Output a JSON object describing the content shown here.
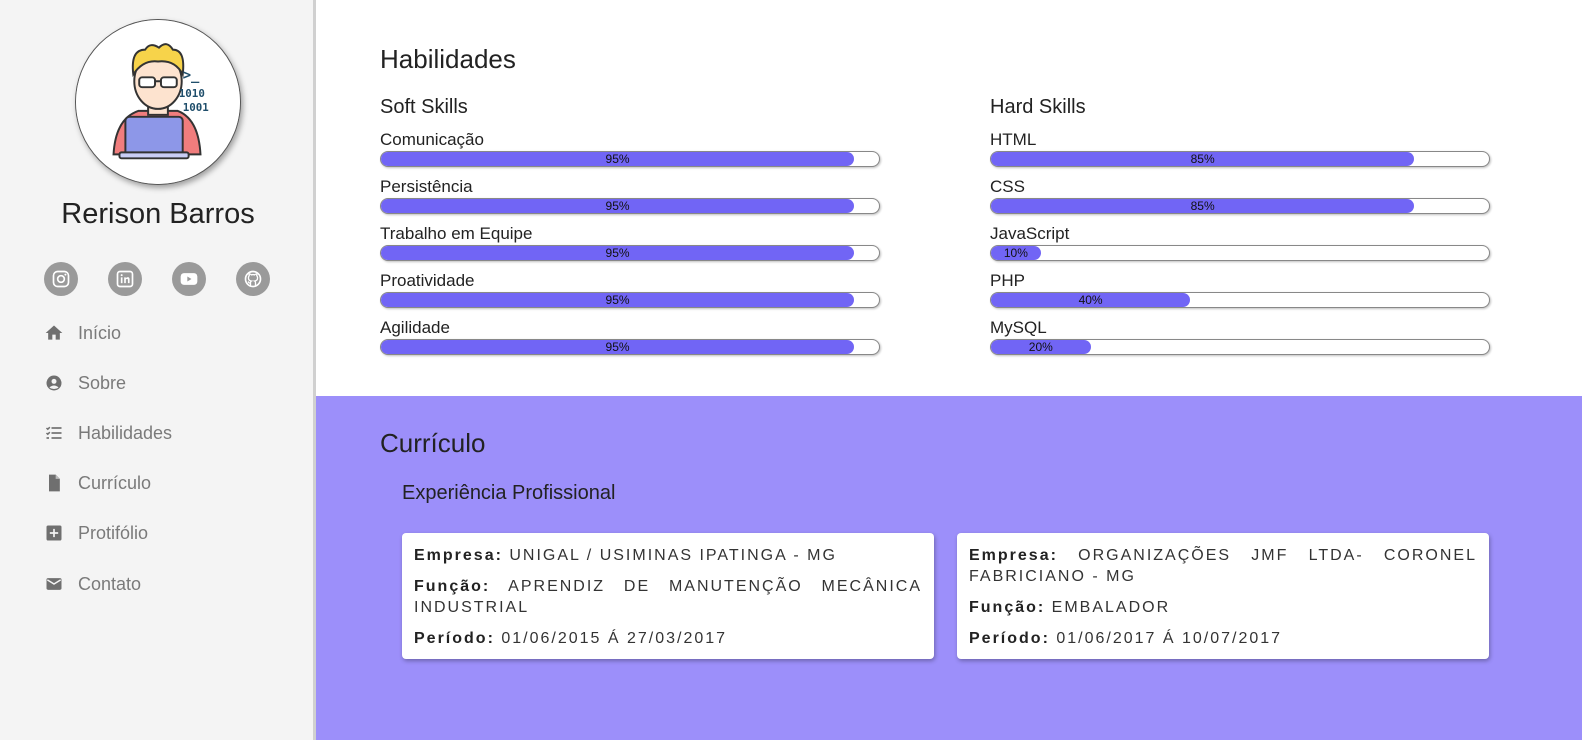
{
  "sidebar": {
    "name": "Rerison Barros",
    "social_icons": [
      "instagram-icon",
      "linkedin-icon",
      "youtube-icon",
      "github-icon"
    ],
    "nav": [
      {
        "label": "Início",
        "icon": "home-icon"
      },
      {
        "label": "Sobre",
        "icon": "account-circle-icon"
      },
      {
        "label": "Habilidades",
        "icon": "checklist-icon"
      },
      {
        "label": "Currículo",
        "icon": "document-icon"
      },
      {
        "label": "Protifólio",
        "icon": "add-box-icon"
      },
      {
        "label": "Contato",
        "icon": "mail-icon"
      }
    ]
  },
  "skills": {
    "title": "Habilidades",
    "soft": {
      "title": "Soft Skills",
      "items": [
        {
          "label": "Comunicação",
          "value": 95,
          "text": "95%"
        },
        {
          "label": "Persistência",
          "value": 95,
          "text": "95%"
        },
        {
          "label": "Trabalho em Equipe",
          "value": 95,
          "text": "95%"
        },
        {
          "label": "Proatividade",
          "value": 95,
          "text": "95%"
        },
        {
          "label": "Agilidade",
          "value": 95,
          "text": "95%"
        }
      ]
    },
    "hard": {
      "title": "Hard Skills",
      "items": [
        {
          "label": "HTML",
          "value": 85,
          "text": "85%"
        },
        {
          "label": "CSS",
          "value": 85,
          "text": "85%"
        },
        {
          "label": "JavaScript",
          "value": 10,
          "text": "10%"
        },
        {
          "label": "PHP",
          "value": 40,
          "text": "40%"
        },
        {
          "label": "MySQL",
          "value": 20,
          "text": "20%"
        }
      ]
    }
  },
  "curriculo": {
    "title": "Currículo",
    "subtitle": "Experiência Profissional",
    "keys": {
      "empresa": "Empresa:",
      "funcao": "Função:",
      "periodo": "Período:"
    },
    "jobs": [
      {
        "empresa": "UNIGAL / USIMINAS IPATINGA - MG",
        "funcao": "APRENDIZ DE MANUTENÇÃO MECÂNICA INDUSTRIAL",
        "periodo": "01/06/2015 á 27/03/2017"
      },
      {
        "empresa": "ORGANIZAÇÕES JMF LTDA- CORONEL FABRICIANO - MG",
        "funcao": "EMBALADOR",
        "periodo": "01/06/2017 á 10/07/2017"
      }
    ]
  },
  "colors": {
    "accent": "#7165f5",
    "section_bg": "#9c8ffa",
    "sidebar_bg": "#f4f4f4",
    "icon_grey": "#9a9a9a"
  }
}
